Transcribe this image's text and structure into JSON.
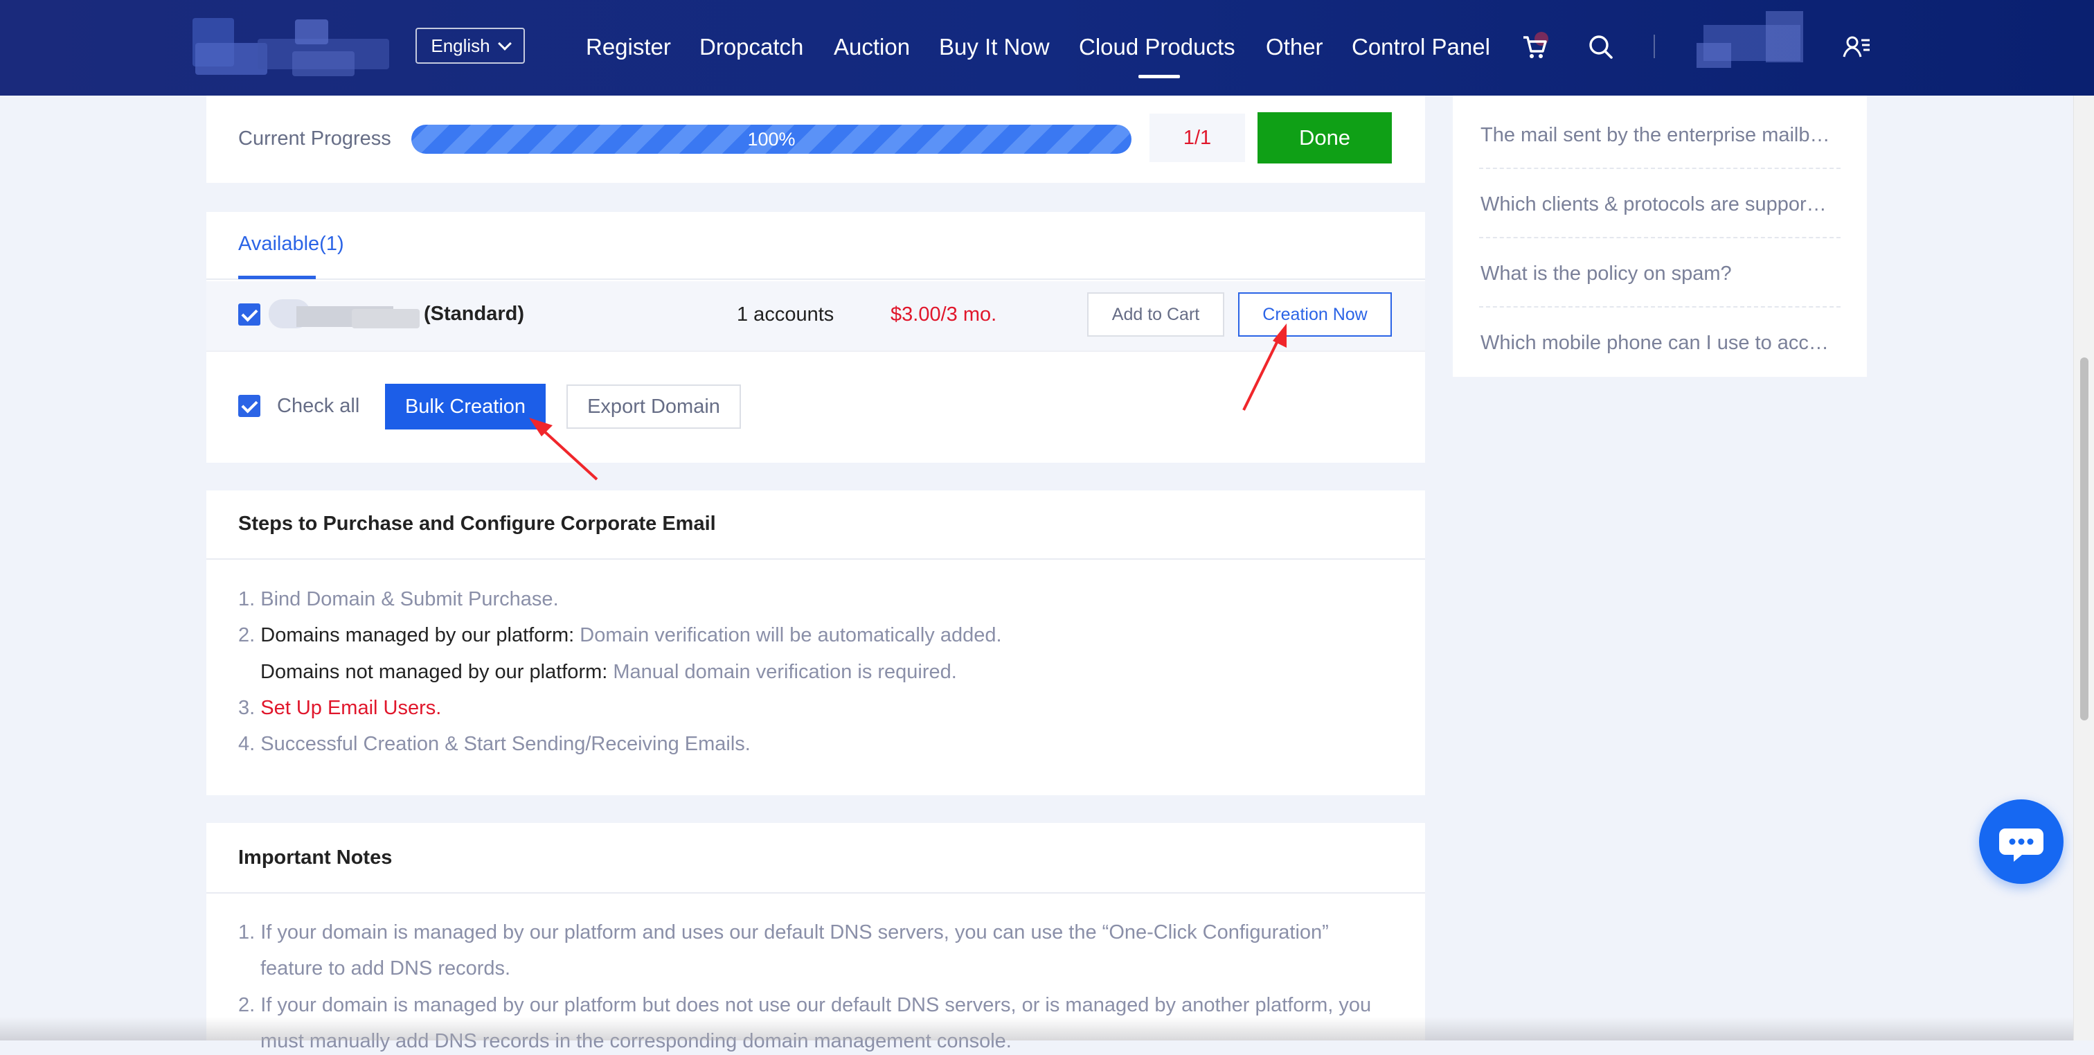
{
  "header": {
    "language": "English",
    "nav": [
      "Register",
      "Dropcatch",
      "Auction",
      "Buy It Now",
      "Cloud Products",
      "Other",
      "Control Panel"
    ],
    "active_nav": "Cloud Products",
    "icons": [
      "cart-icon",
      "search-icon",
      "user-menu-icon"
    ]
  },
  "progress": {
    "label": "Current Progress",
    "percent_text": "100%",
    "value": 1.0,
    "count": "1/1",
    "done_label": "Done"
  },
  "available": {
    "tab_label": "Available(1)",
    "row": {
      "plan": "(Standard)",
      "accounts": "1 accounts",
      "price": "$3.00/3 mo.",
      "add_to_cart": "Add to Cart",
      "creation_now": "Creation Now"
    },
    "check_all": "Check all",
    "bulk_creation": "Bulk Creation",
    "export_domain": "Export Domain"
  },
  "steps": {
    "title": "Steps to Purchase and Configure Corporate Email",
    "items": [
      {
        "num": "1.",
        "text": "Bind Domain & Submit Purchase."
      },
      {
        "num": "2.",
        "prefix": "Domains managed by our platform:",
        "text": "Domain verification will be automatically added."
      },
      {
        "prefix": "Domains not managed by our platform:",
        "text": "Manual domain verification is required."
      },
      {
        "num": "3.",
        "text": "Set Up Email Users."
      },
      {
        "num": "4.",
        "text": "Successful Creation & Start Sending/Receiving Emails."
      }
    ]
  },
  "notes": {
    "title": "Important Notes",
    "items": [
      {
        "num": "1.",
        "line1": "If your domain is managed by our platform and uses our default DNS servers, you can use the “One-Click Configuration”",
        "line2": "feature to add DNS records."
      },
      {
        "num": "2.",
        "line1": "If your domain is managed by our platform but does not use our default DNS servers, or is managed by another platform, you",
        "line2": "must manually add DNS records in the corresponding domain management console."
      }
    ]
  },
  "faq": [
    "The mail sent by the enterprise mailb…",
    "Which clients & protocols are suppor…",
    "What is the policy on spam?",
    "Which mobile phone can I use to acc…"
  ],
  "colors": {
    "header_bg": "#12297f",
    "accent_blue": "#2b64e6",
    "done_green": "#0fa016",
    "price_red": "#e0162b",
    "annotation_arrow": "#f0262b"
  }
}
